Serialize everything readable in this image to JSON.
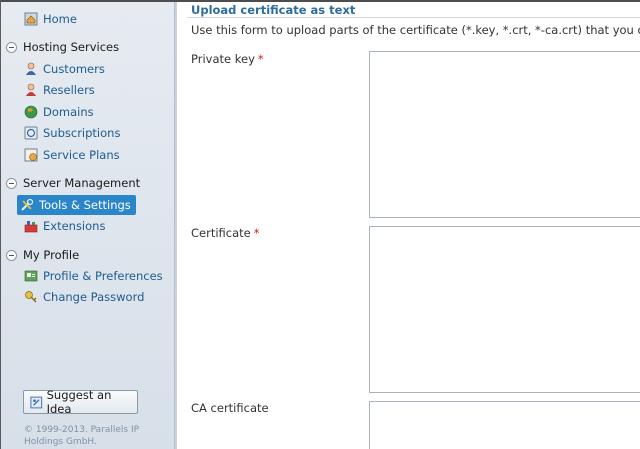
{
  "sidebar": {
    "home": {
      "label": "Home",
      "icon": "home-icon"
    },
    "groups": [
      {
        "title": "Hosting Services",
        "items": [
          {
            "label": "Customers",
            "icon": "customers-icon"
          },
          {
            "label": "Resellers",
            "icon": "resellers-icon"
          },
          {
            "label": "Domains",
            "icon": "domains-icon"
          },
          {
            "label": "Subscriptions",
            "icon": "subscriptions-icon"
          },
          {
            "label": "Service Plans",
            "icon": "service-plans-icon"
          }
        ]
      },
      {
        "title": "Server Management",
        "items": [
          {
            "label": "Tools & Settings",
            "icon": "tools-icon",
            "active": true
          },
          {
            "label": "Extensions",
            "icon": "extensions-icon"
          }
        ]
      },
      {
        "title": "My Profile",
        "items": [
          {
            "label": "Profile & Preferences",
            "icon": "profile-icon"
          },
          {
            "label": "Change Password",
            "icon": "key-icon"
          }
        ]
      }
    ],
    "suggest_label": "Suggest an Idea",
    "copyright_line1": "© 1999-2013. Parallels IP",
    "copyright_line2": "Holdings GmbH."
  },
  "main": {
    "title": "Upload certificate as text",
    "description": "Use this form to upload parts of the certificate (*.key, *.crt, *-ca.crt) that you own,",
    "fields": [
      {
        "label": "Private key",
        "required": "*",
        "value": ""
      },
      {
        "label": "Certificate",
        "required": "*",
        "value": ""
      },
      {
        "label": "CA certificate",
        "required": "",
        "value": ""
      }
    ]
  },
  "colors": {
    "accent": "#2b86c9",
    "link": "#1f5c8f",
    "title": "#2e6b9e",
    "required": "#d61b1b"
  }
}
